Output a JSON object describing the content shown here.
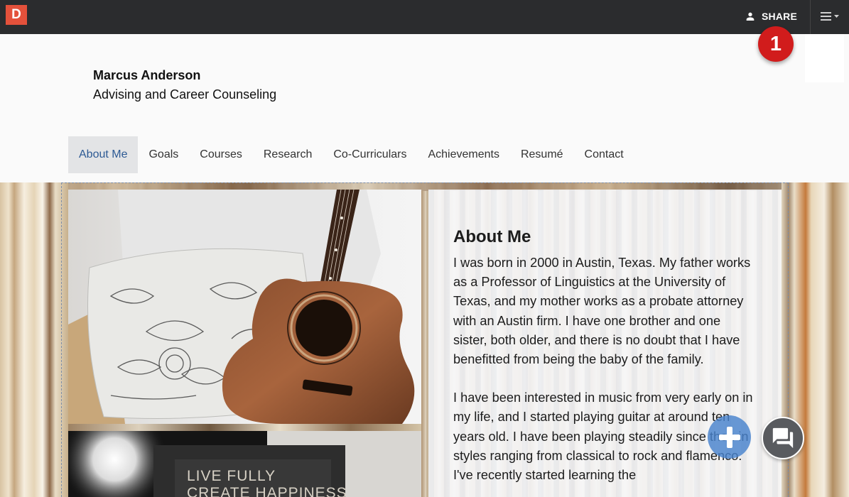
{
  "app": {
    "logo_letter": "D",
    "brand_color": "#e4513b"
  },
  "topbar": {
    "share_label": "SHARE",
    "menu_icon": "hamburger-menu-icon"
  },
  "notification": {
    "count": "1",
    "color": "#d11c1c"
  },
  "profile": {
    "name": "Marcus Anderson",
    "subtitle": "Advising and Career Counseling"
  },
  "nav": {
    "items": [
      {
        "label": "About Me",
        "active": true
      },
      {
        "label": "Goals"
      },
      {
        "label": "Courses"
      },
      {
        "label": "Research"
      },
      {
        "label": "Co-Curriculars"
      },
      {
        "label": "Achievements"
      },
      {
        "label": "Resumé"
      },
      {
        "label": "Contact"
      }
    ],
    "active_color": "#2d5a94"
  },
  "photos": {
    "second_photo_text_line1": "LIVE FULLY",
    "second_photo_text_line2": "CREATE HAPPINESS"
  },
  "about": {
    "title": "About Me",
    "paragraphs": [
      "I was born in 2000 in Austin, Texas. My father works as a Professor of Linguistics at the University of Texas, and my mother works as a probate attorney with an Austin firm. I have one brother and one sister, both older, and there is no doubt that I have benefitted from being the baby of the family.",
      "I have been interested in music from very early on in my life, and I started playing guitar at around ten years old. I have been playing steadily since then in styles ranging from classical to rock and flamenco. I've recently started learning the"
    ]
  },
  "fabs": {
    "add_icon": "plus-icon",
    "chat_icon": "chat-bubbles-icon",
    "add_color": "#4882cd"
  }
}
